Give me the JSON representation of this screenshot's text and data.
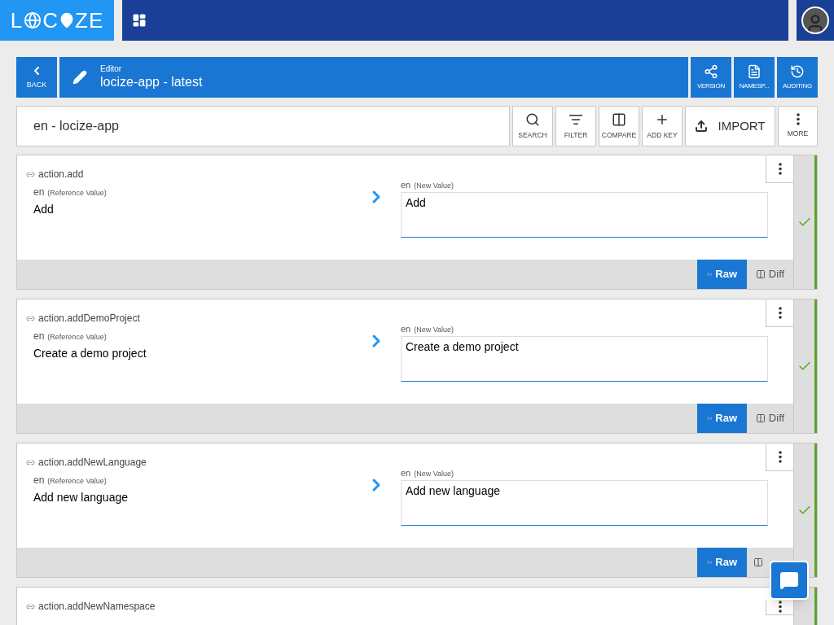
{
  "logo": {
    "first": "L",
    "middle": "C",
    "last": "ZE"
  },
  "header": {
    "back": "BACK",
    "caption": "Editor",
    "title": "locize-app - latest",
    "actions": [
      "VERSION",
      "NAMESP...",
      "AUDITING"
    ]
  },
  "toolbar": {
    "search_value": "en - locize-app",
    "tools": [
      {
        "kind": "search",
        "label": "SEARCH"
      },
      {
        "kind": "filter",
        "label": "FILTER"
      },
      {
        "kind": "compare",
        "label": "COMPARE"
      },
      {
        "kind": "add",
        "label": "ADD KEY"
      }
    ],
    "import": "IMPORT",
    "more": "MORE"
  },
  "entries": [
    {
      "key": "action.add",
      "ref_lang": "en",
      "ref_note": "(Reference Value)",
      "ref_value": "Add",
      "new_lang": "en",
      "new_note": "(New Value)",
      "new_value": "Add",
      "raw": "Raw",
      "diff": "Diff",
      "raw_selected": true,
      "done": true
    },
    {
      "key": "action.addDemoProject",
      "ref_lang": "en",
      "ref_note": "(Reference Value)",
      "ref_value": "Create a demo project",
      "new_lang": "en",
      "new_note": "(New Value)",
      "new_value": "Create a demo project",
      "raw": "Raw",
      "diff": "Diff",
      "raw_selected": true,
      "done": true
    },
    {
      "key": "action.addNewLanguage",
      "ref_lang": "en",
      "ref_note": "(Reference Value)",
      "ref_value": "Add new language",
      "new_lang": "en",
      "new_note": "(New Value)",
      "new_value": "Add new language",
      "raw": "Raw",
      "raw_selected": true,
      "done": true
    },
    {
      "key": "action.addNewNamespace",
      "done": true
    }
  ]
}
